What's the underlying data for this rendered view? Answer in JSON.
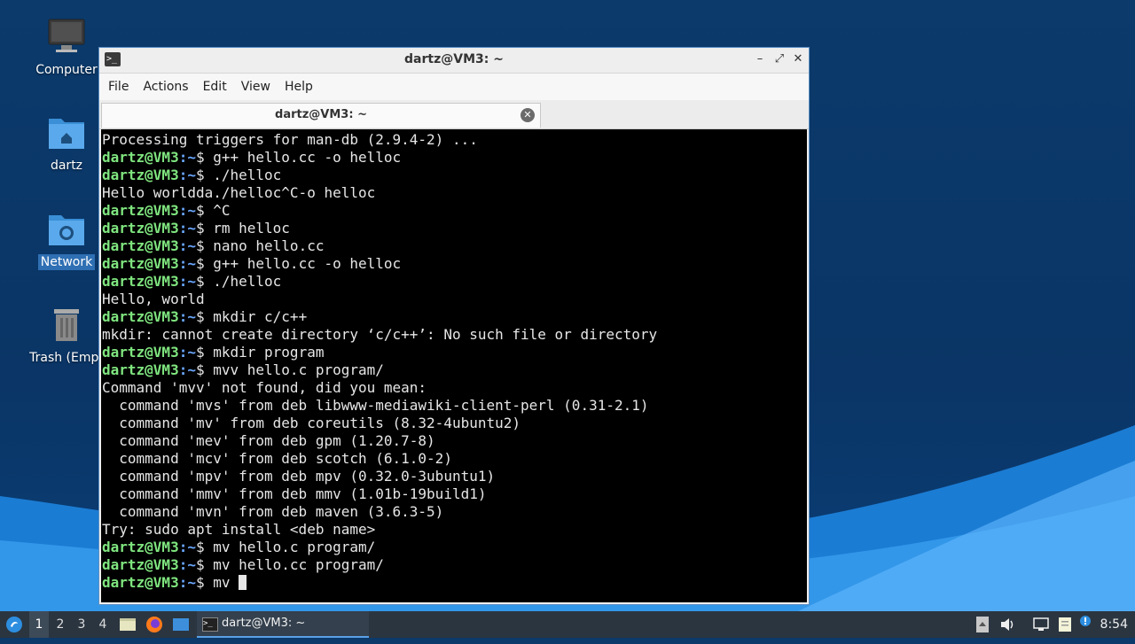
{
  "desktop": {
    "icons": [
      {
        "label": "Computer"
      },
      {
        "label": "dartz"
      },
      {
        "label": "Network"
      },
      {
        "label": "Trash (Empt"
      }
    ]
  },
  "window": {
    "title": "dartz@VM3: ~",
    "menu": [
      "File",
      "Actions",
      "Edit",
      "View",
      "Help"
    ],
    "tab_title": "dartz@VM3: ~",
    "controls": {
      "minimize": "–",
      "maximize": "⤢",
      "close": "✕"
    }
  },
  "terminal": {
    "prompt_user": "dartz@VM3",
    "prompt_path": ":~",
    "prompt_symbol": "$ ",
    "lines": [
      {
        "type": "out",
        "text": "Processing triggers for man-db (2.9.4-2) ..."
      },
      {
        "type": "cmd",
        "text": "g++ hello.cc -o helloc"
      },
      {
        "type": "cmd",
        "text": "./helloc"
      },
      {
        "type": "out",
        "text": "Hello worldda./helloc^C-o helloc"
      },
      {
        "type": "cmd",
        "text": "^C"
      },
      {
        "type": "cmd",
        "text": "rm helloc"
      },
      {
        "type": "cmd",
        "text": "nano hello.cc"
      },
      {
        "type": "cmd",
        "text": "g++ hello.cc -o helloc"
      },
      {
        "type": "cmd",
        "text": "./helloc"
      },
      {
        "type": "out",
        "text": "Hello, world"
      },
      {
        "type": "cmd",
        "text": "mkdir c/c++"
      },
      {
        "type": "out",
        "text": "mkdir: cannot create directory ‘c/c++’: No such file or directory"
      },
      {
        "type": "cmd",
        "text": "mkdir program"
      },
      {
        "type": "cmd",
        "text": "mvv hello.c program/"
      },
      {
        "type": "out",
        "text": "Command 'mvv' not found, did you mean:"
      },
      {
        "type": "out",
        "text": "  command 'mvs' from deb libwww-mediawiki-client-perl (0.31-2.1)"
      },
      {
        "type": "out",
        "text": "  command 'mv' from deb coreutils (8.32-4ubuntu2)"
      },
      {
        "type": "out",
        "text": "  command 'mev' from deb gpm (1.20.7-8)"
      },
      {
        "type": "out",
        "text": "  command 'mcv' from deb scotch (6.1.0-2)"
      },
      {
        "type": "out",
        "text": "  command 'mpv' from deb mpv (0.32.0-3ubuntu1)"
      },
      {
        "type": "out",
        "text": "  command 'mmv' from deb mmv (1.01b-19build1)"
      },
      {
        "type": "out",
        "text": "  command 'mvn' from deb maven (3.6.3-5)"
      },
      {
        "type": "out",
        "text": "Try: sudo apt install <deb name>"
      },
      {
        "type": "cmd",
        "text": "mv hello.c program/"
      },
      {
        "type": "cmd",
        "text": "mv hello.cc program/"
      },
      {
        "type": "cmd",
        "text": "mv ",
        "cursor": true
      }
    ]
  },
  "taskbar": {
    "workspaces": [
      "1",
      "2",
      "3",
      "4"
    ],
    "active_workspace": "1",
    "task_label": "dartz@VM3: ~",
    "clock": "8:54"
  }
}
